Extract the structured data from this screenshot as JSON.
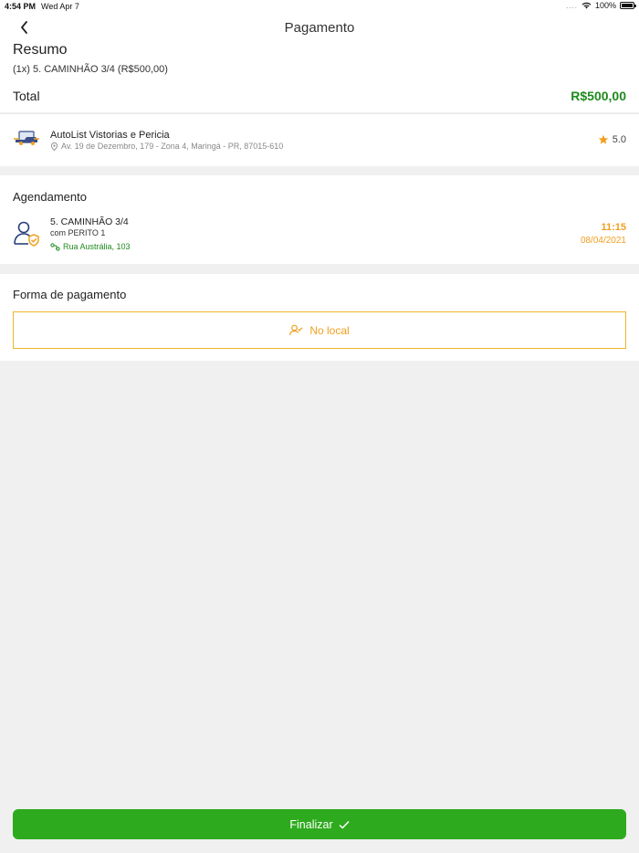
{
  "status_bar": {
    "time": "4:54 PM",
    "date": "Wed Apr 7",
    "signal": "....",
    "battery": "100%"
  },
  "nav": {
    "title": "Pagamento"
  },
  "summary": {
    "heading": "Resumo",
    "line_item": "(1x) 5. CAMINHÃO 3/4 (R$500,00)",
    "total_label": "Total",
    "total_value": "R$500,00"
  },
  "provider": {
    "name": "AutoList Vistorias e Pericia",
    "address": "Av. 19 de Dezembro, 179 - Zona 4, Maringá - PR, 87015-610",
    "rating": "5.0"
  },
  "schedule": {
    "heading": "Agendamento",
    "service": "5. CAMINHÃO 3/4",
    "with": "com PERITO 1",
    "location": "Rua Austrália, 103",
    "time": "11:15",
    "date": "08/04/2021"
  },
  "payment": {
    "heading": "Forma de pagamento",
    "option": "No local"
  },
  "footer": {
    "finalize_label": "Finalizar"
  },
  "colors": {
    "green": "#1e8a1e",
    "button_green": "#2eaa1e",
    "amber": "#f0a020"
  }
}
